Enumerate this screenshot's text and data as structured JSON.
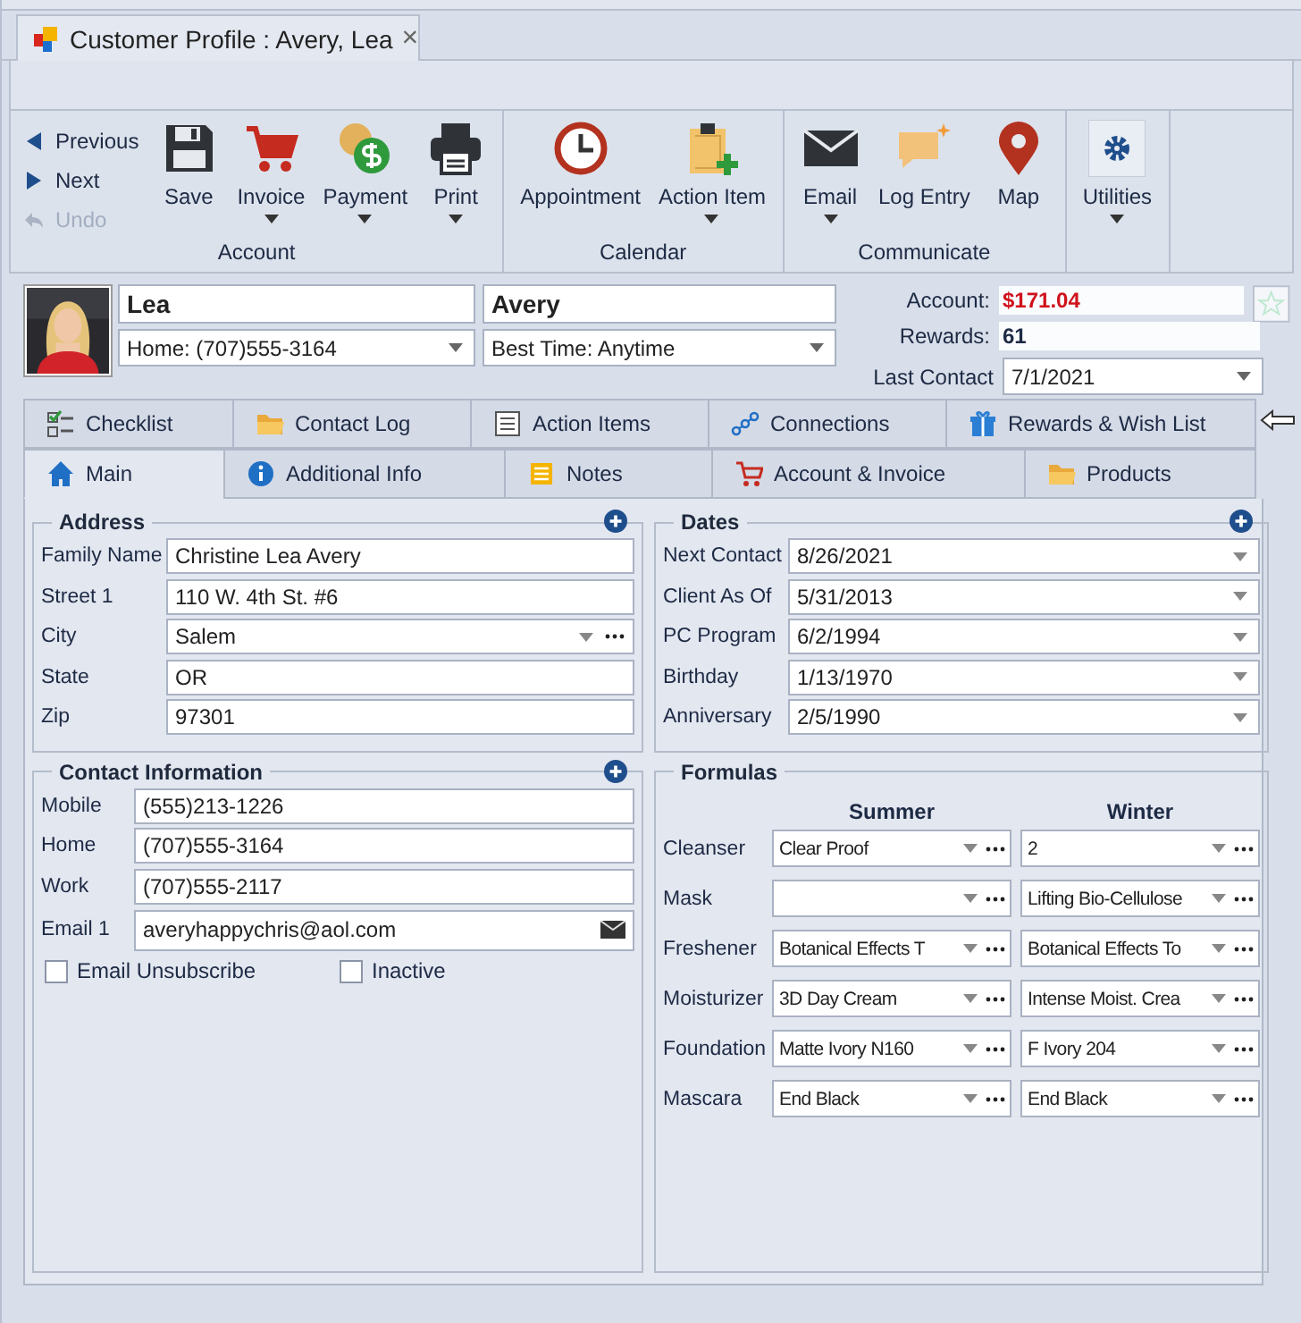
{
  "document_tab": {
    "title": "Customer Profile : Avery, Lea",
    "close": "×"
  },
  "ribbon": {
    "nav": [
      {
        "label": "Previous",
        "disabled": false
      },
      {
        "label": "Next",
        "disabled": false
      },
      {
        "label": "Undo",
        "disabled": true
      }
    ],
    "groups": [
      {
        "label": "Account",
        "items": [
          {
            "label": "Save",
            "dropdown": false
          },
          {
            "label": "Invoice",
            "dropdown": true
          },
          {
            "label": "Payment",
            "dropdown": true
          },
          {
            "label": "Print",
            "dropdown": true
          }
        ]
      },
      {
        "label": "Calendar",
        "items": [
          {
            "label": "Appointment",
            "dropdown": false
          },
          {
            "label": "Action Item",
            "dropdown": true
          }
        ]
      },
      {
        "label": "Communicate",
        "items": [
          {
            "label": "Email",
            "dropdown": true
          },
          {
            "label": "Log Entry",
            "dropdown": false
          },
          {
            "label": "Map",
            "dropdown": false
          }
        ]
      },
      {
        "items": [
          {
            "label": "Utilities",
            "dropdown": true
          }
        ]
      }
    ]
  },
  "profile": {
    "first_name": "Lea",
    "last_name": "Avery",
    "phone": "Home: (707)555-3164",
    "best_time": "Best Time: Anytime",
    "account": {
      "label": "Account:",
      "value": "$171.04"
    },
    "rewards": {
      "label": "Rewards:",
      "value": "61"
    },
    "last_contact": {
      "label": "Last Contact",
      "value": "7/1/2021"
    }
  },
  "tabs": [
    [
      {
        "label": "Checklist",
        "selected": false
      },
      {
        "label": "Contact Log",
        "selected": false
      },
      {
        "label": "Action Items",
        "selected": false
      },
      {
        "label": "Connections",
        "selected": false
      },
      {
        "label": "Rewards & Wish List",
        "selected": false
      }
    ],
    [
      {
        "label": "Main",
        "selected": true
      },
      {
        "label": "Additional Info",
        "selected": false
      },
      {
        "label": "Notes",
        "selected": false
      },
      {
        "label": "Account & Invoice",
        "selected": false
      },
      {
        "label": "Products",
        "selected": false
      }
    ]
  ],
  "address": {
    "title": "Address",
    "fields": [
      {
        "label": "Family Name",
        "value": "Christine Lea Avery",
        "kind": "text"
      },
      {
        "label": "Street 1",
        "value": "110 W. 4th St. #6",
        "kind": "text"
      },
      {
        "label": "City",
        "value": "Salem",
        "kind": "lookup"
      },
      {
        "label": "State",
        "value": "OR",
        "kind": "text"
      },
      {
        "label": "Zip",
        "value": "97301",
        "kind": "text"
      }
    ]
  },
  "contact": {
    "title": "Contact Information",
    "fields": [
      {
        "label": "Mobile",
        "value": "(555)213-1226",
        "kind": "text"
      },
      {
        "label": "Home",
        "value": "(707)555-3164",
        "kind": "text"
      },
      {
        "label": "Work",
        "value": "(707)555-2117",
        "kind": "text"
      },
      {
        "label": "Email 1",
        "value": "averyhappychris@aol.com",
        "kind": "email"
      }
    ],
    "checkboxes": [
      {
        "label": "Email Unsubscribe",
        "checked": false
      },
      {
        "label": "Inactive",
        "checked": false
      }
    ]
  },
  "dates": {
    "title": "Dates",
    "fields": [
      {
        "label": "Next Contact",
        "value": "8/26/2021"
      },
      {
        "label": "Client As Of",
        "value": "5/31/2013"
      },
      {
        "label": "PC Program",
        "value": "6/2/1994"
      },
      {
        "label": "Birthday",
        "value": "1/13/1970"
      },
      {
        "label": "Anniversary",
        "value": "2/5/1990"
      }
    ]
  },
  "formulas": {
    "title": "Formulas",
    "columns": [
      "Summer",
      "Winter"
    ],
    "rows": [
      {
        "label": "Cleanser",
        "summer": "Clear Proof",
        "winter": "2"
      },
      {
        "label": "Mask",
        "winter": "Lifting Bio-Cellulose"
      },
      {
        "label": "Freshener",
        "summer": "Botanical Effects T",
        "winter": "Botanical Effects To"
      },
      {
        "label": "Moisturizer",
        "summer": "3D Day Cream",
        "winter": "Intense Moist. Crea"
      },
      {
        "label": "Foundation",
        "summer": "Matte Ivory N160",
        "winter": "F Ivory 204"
      },
      {
        "label": "Mascara",
        "summer": "End Black",
        "winter": "End Black"
      }
    ]
  }
}
